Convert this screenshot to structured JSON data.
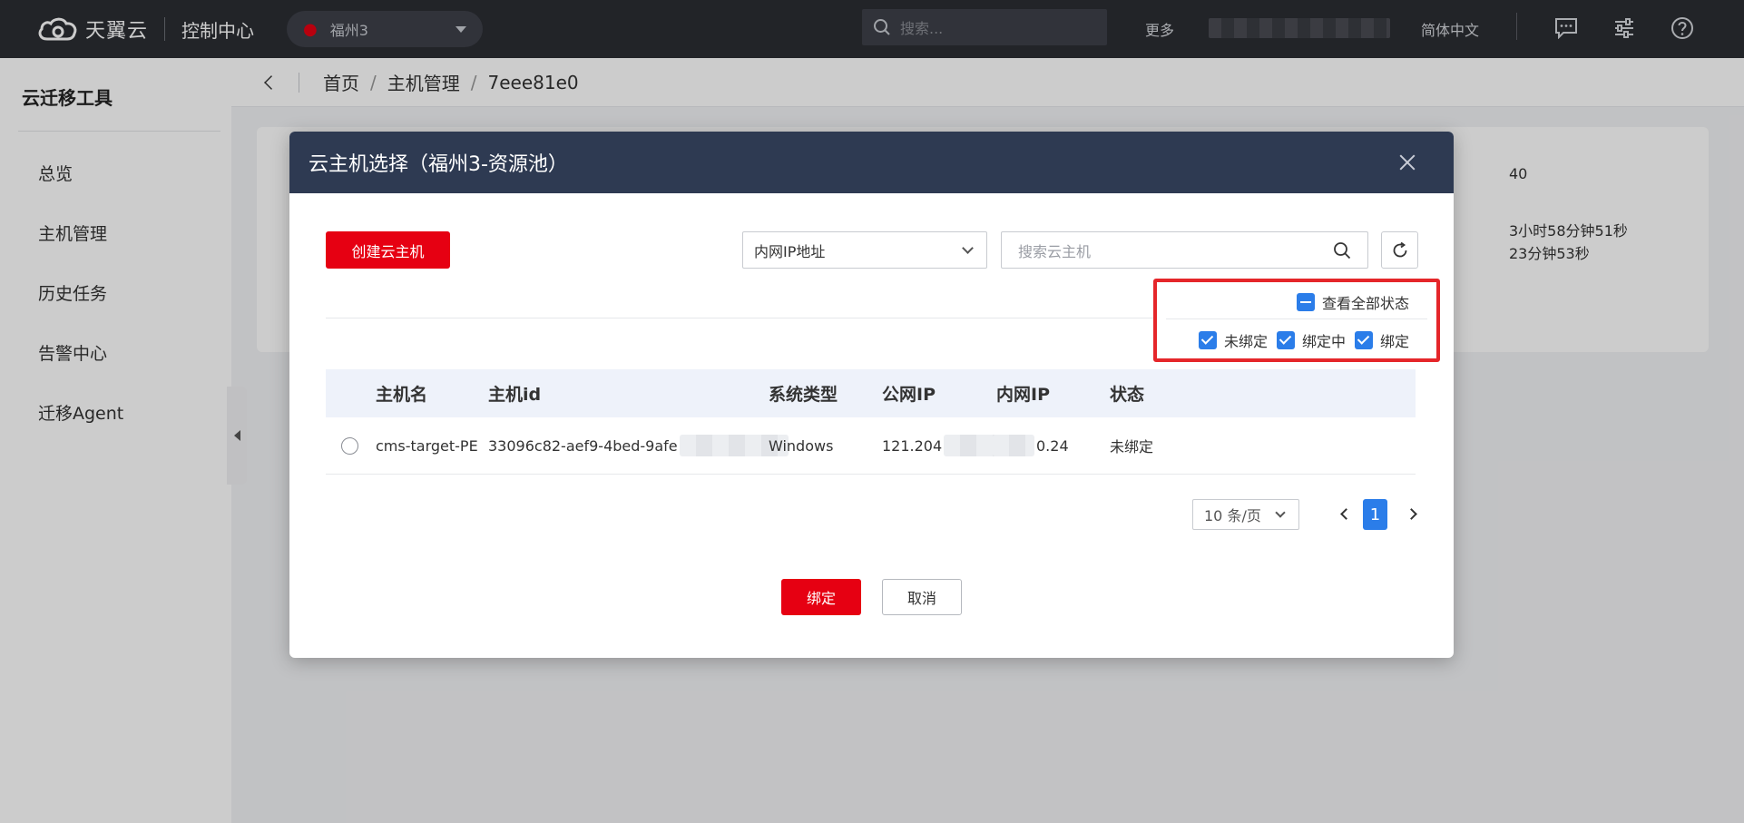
{
  "header": {
    "logo_text": "天翼云",
    "console_title": "控制中心",
    "region": "福州3",
    "search_placeholder": "搜索...",
    "more": "更多",
    "language": "简体中文",
    "icons": [
      "message-icon",
      "settings-sliders-icon",
      "help-icon"
    ]
  },
  "sidebar": {
    "title": "云迁移工具",
    "items": [
      {
        "label": "总览"
      },
      {
        "label": "主机管理"
      },
      {
        "label": "历史任务"
      },
      {
        "label": "告警中心"
      },
      {
        "label": "迁移Agent"
      }
    ]
  },
  "breadcrumb": {
    "items": [
      "首页",
      "主机管理",
      "7eee81e0"
    ],
    "separator": "/"
  },
  "background_card": {
    "value_1": "40",
    "value_2": "3小时58分钟51秒",
    "value_3": "23分钟53秒"
  },
  "modal": {
    "title": "云主机选择（福州3-资源池）",
    "create_button": "创建云主机",
    "filter_select": "内网IP地址",
    "search_placeholder": "搜索云主机",
    "status_filter": {
      "all_label": "查看全部状态",
      "options": [
        {
          "label": "未绑定",
          "checked": true
        },
        {
          "label": "绑定中",
          "checked": true
        },
        {
          "label": "绑定",
          "checked": true
        }
      ]
    },
    "table": {
      "columns": [
        "主机名",
        "主机id",
        "系统类型",
        "公网IP",
        "内网IP",
        "状态"
      ],
      "rows": [
        {
          "name": "cms-target-PE",
          "id": "33096c82-aef9-4bed-9afe",
          "os": "Windows",
          "public_ip": "121.204",
          "private_ip": "0.24",
          "status": "未绑定"
        }
      ]
    },
    "pagination": {
      "page_size": "10 条/页",
      "current_page": "1"
    },
    "bind_button": "绑定",
    "cancel_button": "取消"
  },
  "colors": {
    "brand_red": "#e60012",
    "accent_blue": "#2b7de9",
    "header_dark": "#2b2d33",
    "modal_header": "#2e3a52",
    "highlight_border": "#e5262a"
  }
}
